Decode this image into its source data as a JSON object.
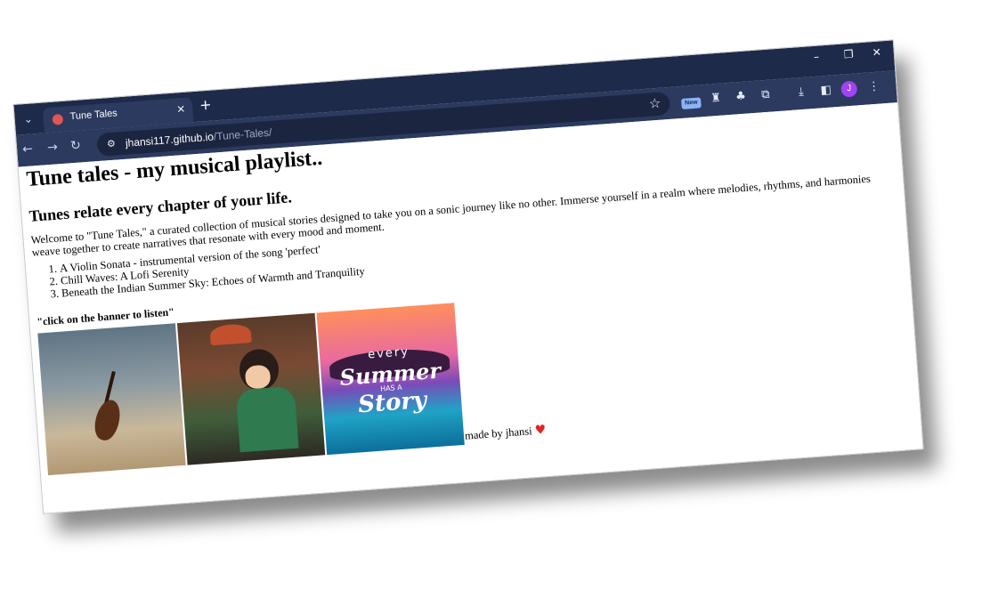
{
  "browser": {
    "tab_title": "Tune Tales",
    "tab_close": "×",
    "new_tab": "+",
    "url_host": "jhansi117.github.io",
    "url_path": "/Tune-Tales/",
    "ext_new_badge": "New",
    "profile_initial": "J",
    "icons": [
      "tab-search-icon",
      "tab-favicon",
      "back-icon",
      "forward-icon",
      "reload-icon",
      "site-info-icon",
      "bookmark-star-icon",
      "extension-new-icon",
      "extension-bottle-icon",
      "extension-tree-icon",
      "extensions-puzzle-icon",
      "downloads-icon",
      "side-panel-icon",
      "menu-kebab-icon",
      "minimize-icon",
      "restore-icon",
      "close-window-icon"
    ]
  },
  "page": {
    "heading": "Tune tales - my musical playlist..",
    "subheading": "Tunes relate every chapter of your life.",
    "intro": "Welcome to \"Tune Tales,\" a curated collection of musical stories designed to take you on a sonic journey like no other. Immerse yourself in a realm where melodies, rhythms, and harmonies weave together to create narratives that resonate with every mood and moment.",
    "playlist": [
      "A Violin Sonata - instrumental version of the song 'perfect'",
      "Chill Waves: A Lofi Serenity",
      "Beneath the Indian Summer Sky: Echoes of Warmth and Tranquility"
    ],
    "hint": "\"click on the banner to listen\"",
    "banners": {
      "summer_text_1": "every",
      "summer_text_2": "Summer",
      "summer_text_3": "HAS A",
      "summer_text_4": "Story"
    },
    "footer": "made by jhansi",
    "footer_heart": "♥"
  }
}
